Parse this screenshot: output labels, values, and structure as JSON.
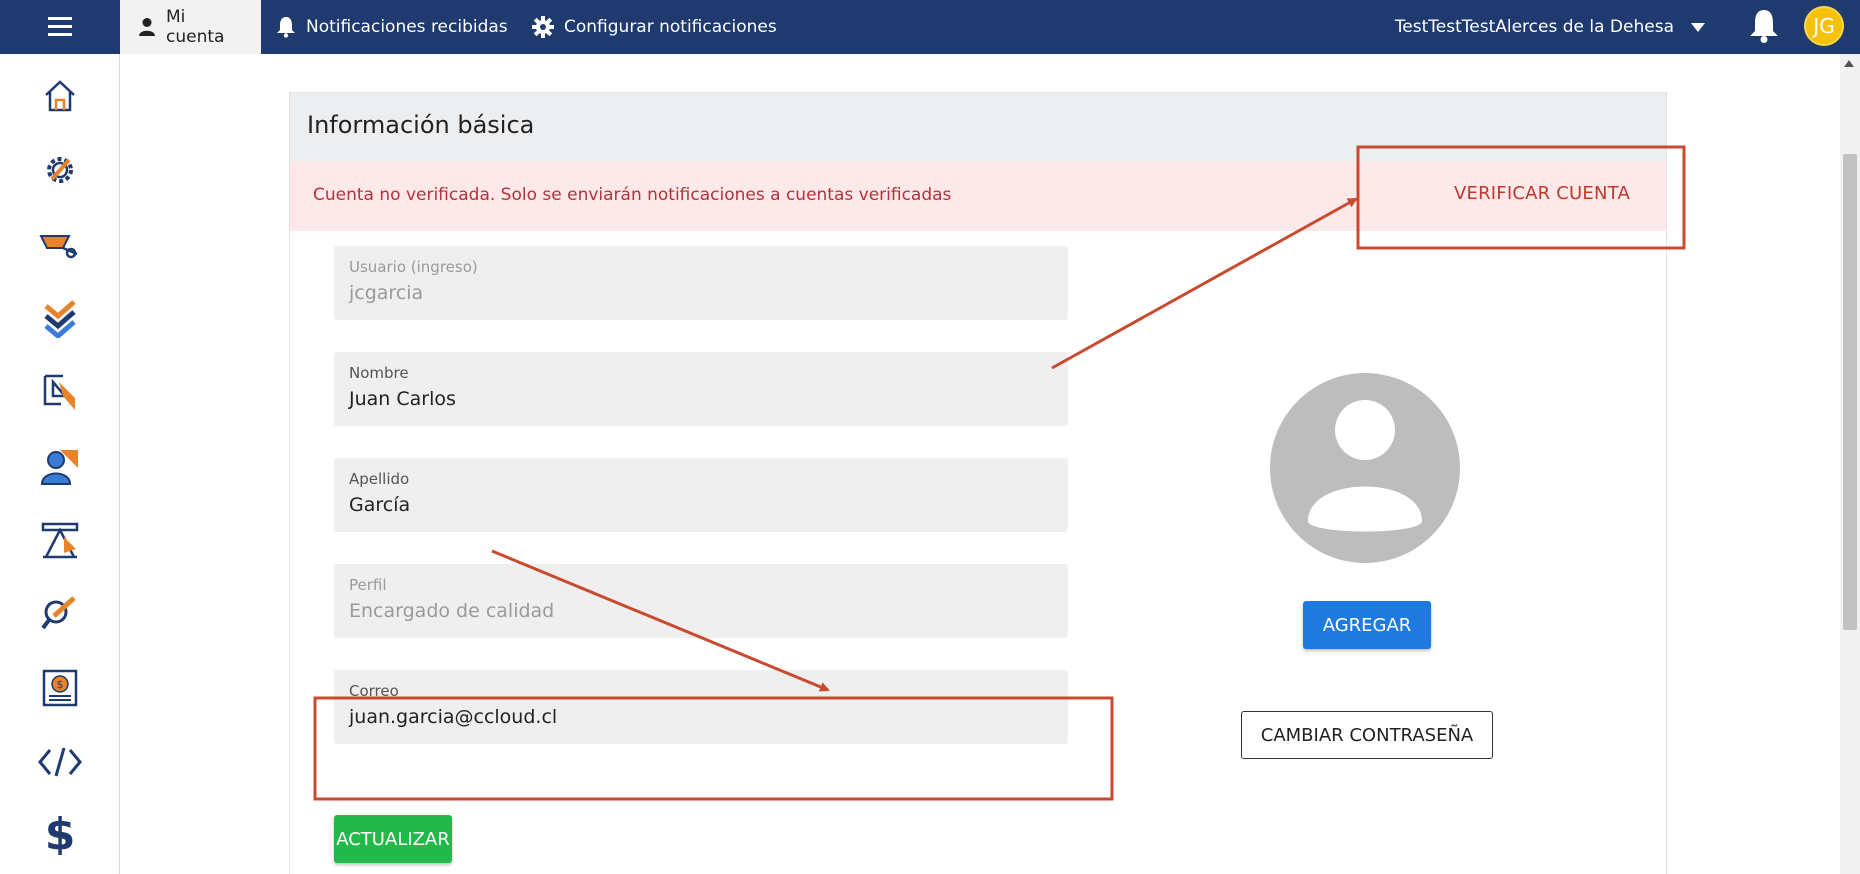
{
  "topbar": {
    "menu_icon": "hamburger-menu-icon",
    "tabs": [
      {
        "label": "Mi cuenta",
        "icon": "user-icon",
        "active": true
      },
      {
        "label": "Notificaciones recibidas",
        "icon": "bell-icon",
        "active": false
      },
      {
        "label": "Configurar notificaciones",
        "icon": "gear-icon",
        "active": false
      }
    ],
    "organization": "TestTestTestAlerces de la Dehesa",
    "user_initials": "JG",
    "colors": {
      "bar": "#1f3a6e",
      "avatar": "#f5c20b"
    }
  },
  "sidebar": {
    "items": [
      {
        "icon": "home-icon"
      },
      {
        "icon": "settings-pencil-icon"
      },
      {
        "icon": "wheelbarrow-icon"
      },
      {
        "icon": "checklist-icon"
      },
      {
        "icon": "document-arrow-icon"
      },
      {
        "icon": "user-group-icon"
      },
      {
        "icon": "blueprint-icon"
      },
      {
        "icon": "magnifier-pencil-icon"
      },
      {
        "icon": "money-box-icon"
      },
      {
        "icon": "code-icon"
      },
      {
        "icon": "dollar-icon"
      }
    ]
  },
  "card": {
    "title": "Información básica",
    "alert": {
      "message": "Cuenta no verificada. Solo se enviarán notificaciones a cuentas verificadas",
      "action": "VERIFICAR CUENTA"
    },
    "fields": [
      {
        "label": "Usuario (ingreso)",
        "value": "jcgarcia",
        "disabled": true
      },
      {
        "label": "Nombre",
        "value": "Juan Carlos",
        "disabled": false
      },
      {
        "label": "Apellido",
        "value": "García",
        "disabled": false
      },
      {
        "label": "Perfil",
        "value": "Encargado de calidad",
        "disabled": true
      },
      {
        "label": "Correo",
        "value": "juan.garcia@ccloud.cl",
        "disabled": false
      }
    ],
    "update_button": "ACTUALIZAR",
    "add_button": "AGREGAR",
    "change_password_button": "CAMBIAR CONTRASEÑA"
  },
  "annotation_color": "#c94a2f"
}
